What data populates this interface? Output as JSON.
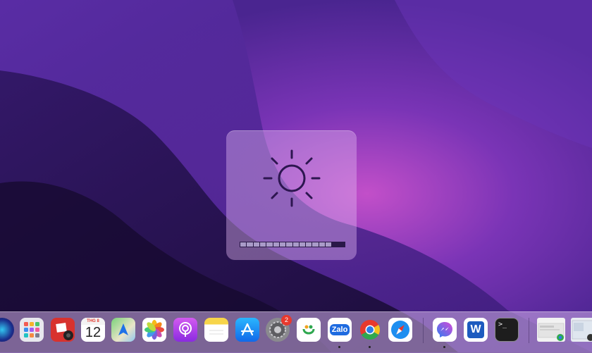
{
  "brightness": {
    "level": 0.85,
    "segments": 16,
    "lit_segments": 14
  },
  "dock": {
    "apps": [
      {
        "name": "Siri",
        "icon": "siri-icon",
        "running": false
      },
      {
        "name": "Launchpad",
        "icon": "launchpad-icon",
        "running": false
      },
      {
        "name": "Photo Booth",
        "icon": "photo-booth-icon",
        "running": false
      },
      {
        "name": "Calendar",
        "icon": "calendar-icon",
        "month": "THG 8",
        "day": "12",
        "running": false
      },
      {
        "name": "Maps",
        "icon": "maps-icon",
        "running": false
      },
      {
        "name": "Photos",
        "icon": "photos-icon",
        "running": false
      },
      {
        "name": "Podcasts",
        "icon": "podcasts-icon",
        "running": false
      },
      {
        "name": "Notes",
        "icon": "notes-icon",
        "running": false
      },
      {
        "name": "App Store",
        "icon": "app-store-icon",
        "running": false
      },
      {
        "name": "System Preferences",
        "icon": "gear-icon",
        "badge": "2",
        "running": false
      },
      {
        "name": "Coc Coc",
        "icon": "coccoc-icon",
        "running": false
      },
      {
        "name": "Zalo",
        "icon": "zalo-icon",
        "label": "Zalo",
        "running": true
      },
      {
        "name": "Google Chrome",
        "icon": "chrome-icon",
        "running": true
      },
      {
        "name": "Safari",
        "icon": "safari-icon",
        "running": false
      },
      {
        "name": "Messenger",
        "icon": "messenger-icon",
        "running": true
      },
      {
        "name": "Microsoft Word",
        "icon": "word-icon",
        "label": "W",
        "running": false
      },
      {
        "name": "Terminal",
        "icon": "terminal-icon",
        "label": ">_",
        "running": false
      },
      {
        "name": "Chrome window thumbnail",
        "icon": "window-thumbnail-icon",
        "running": false
      },
      {
        "name": "Finder window thumbnail",
        "icon": "window-thumbnail-icon",
        "running": false
      }
    ]
  },
  "colors": {
    "wallpaper_dark": "#1c0f3d",
    "wallpaper_mid": "#5a2a9a",
    "wallpaper_light": "#c05ad0",
    "hud_icon": "#2d1650",
    "badge": "#e8392d"
  }
}
